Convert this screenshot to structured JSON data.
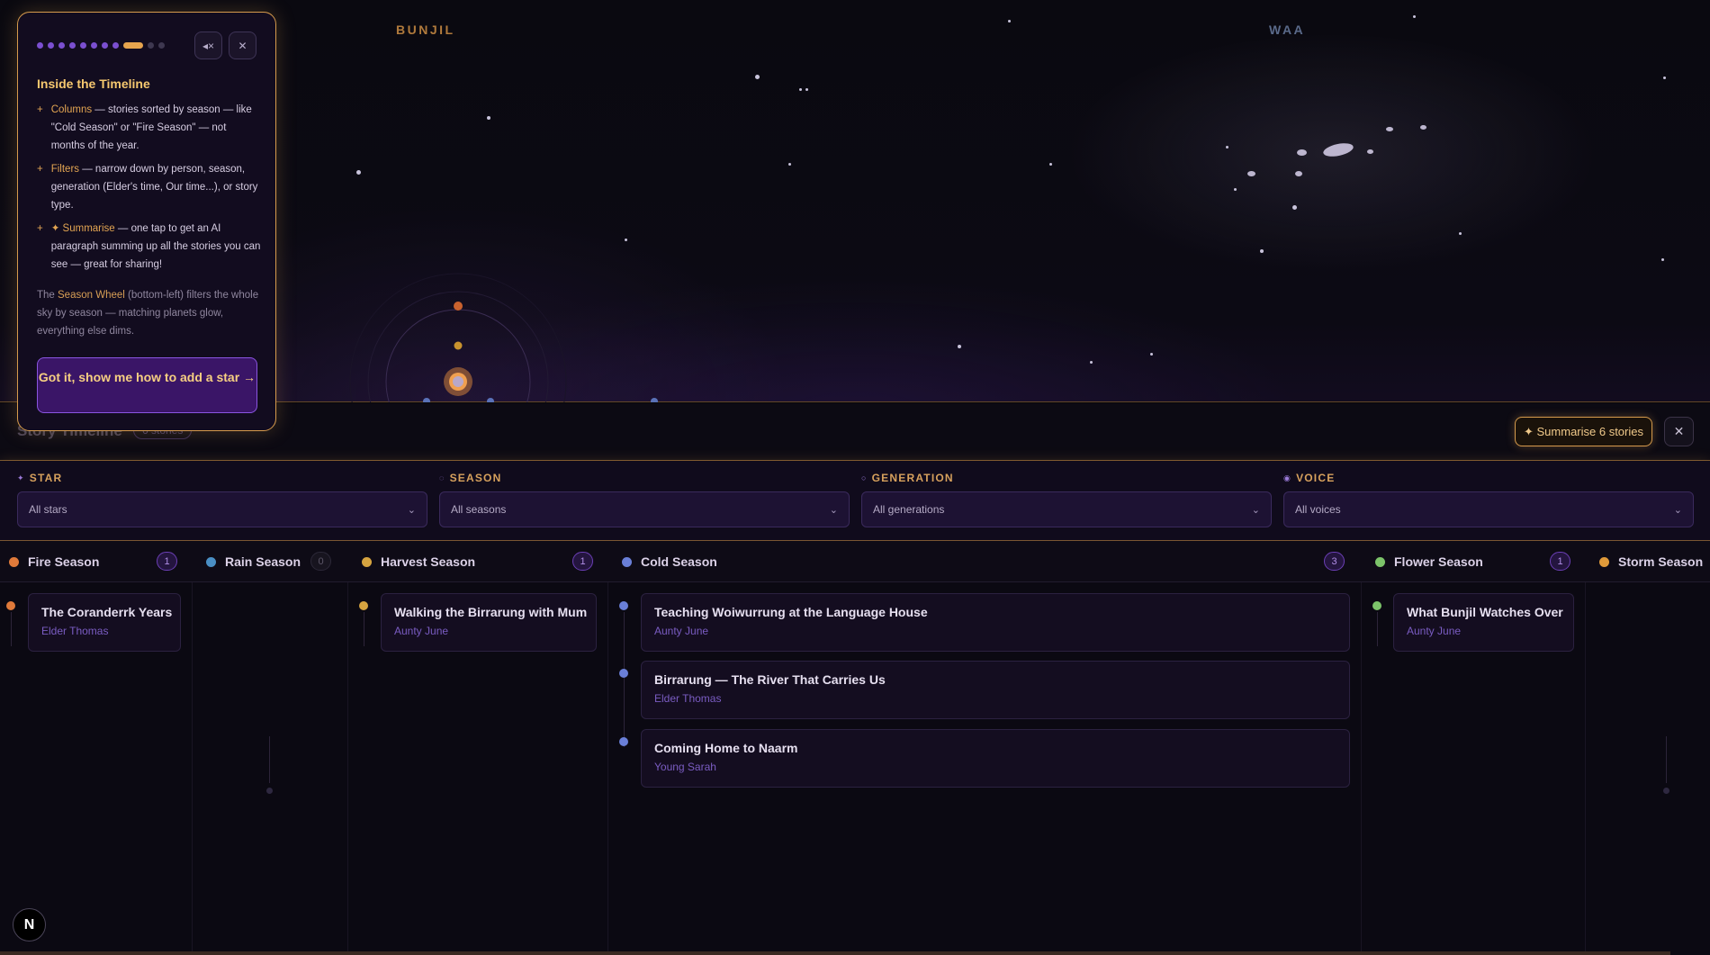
{
  "sky": {
    "labels": [
      {
        "text": "BUNJIL",
        "color": "#b07a3c"
      },
      {
        "text": "WAA",
        "color": "#5a6a8a"
      }
    ]
  },
  "tour": {
    "step_dots": 12,
    "active_step": 9,
    "mute_icon": "mute-icon",
    "close_icon": "close-icon",
    "title": "Inside the Timeline",
    "bullets": [
      {
        "marker": "+",
        "highlight": "Columns",
        "text": " — stories sorted by season — like \"Cold Season\" or \"Fire Season\" — not months of the year."
      },
      {
        "marker": "+",
        "highlight": "Filters",
        "text": " — narrow down by person, season, generation (Elder's time, Our time...), or story type."
      },
      {
        "marker": "+",
        "highlight": "✦ Summarise",
        "text": " — one tap to get an AI paragraph summing up all the stories you can see — great for sharing!"
      }
    ],
    "footer_pre": "The ",
    "footer_highlight": "Season Wheel",
    "footer_post": " (bottom-left) filters the whole sky by season — matching planets glow, everything else dims.",
    "cta_label": "Got it, show me how to add a star →"
  },
  "panel": {
    "title": "Story Timeline",
    "count": "6 stories",
    "summarise_label": "✦ Summarise 6 stories",
    "close_label": "✕"
  },
  "filters": [
    {
      "label": "STAR",
      "value": "All stars"
    },
    {
      "label": "SEASON",
      "value": "All seasons"
    },
    {
      "label": "GENERATION",
      "value": "All generations"
    },
    {
      "label": "VOICE",
      "value": "All voices"
    }
  ],
  "seasons": [
    {
      "name": "Fire Season",
      "count": "1",
      "color": "#e07a3a"
    },
    {
      "name": "Rain Season",
      "count": "0",
      "color": "#4a8fc4"
    },
    {
      "name": "Harvest Season",
      "count": "1",
      "color": "#d6a440"
    },
    {
      "name": "Cold Season",
      "count": "3",
      "color": "#6a7fd8"
    },
    {
      "name": "Flower Season",
      "count": "1",
      "color": "#7cc46a"
    },
    {
      "name": "Storm Season",
      "count": "",
      "color": "#e09a3a"
    }
  ],
  "stories": [
    {
      "title": "The Coranderrk Years",
      "voice": "Elder Thomas"
    },
    {
      "title": "Walking the Birrarung with Mum",
      "voice": "Aunty June"
    },
    {
      "title": "Teaching Woiwurrung at the Language House",
      "voice": "Aunty June"
    },
    {
      "title": "Birrarung — The River That Carries Us",
      "voice": "Elder Thomas"
    },
    {
      "title": "Coming Home to Naarm",
      "voice": "Young Sarah"
    },
    {
      "title": "What Bunjil Watches Over",
      "voice": "Aunty June"
    }
  ],
  "n_badge": "N"
}
